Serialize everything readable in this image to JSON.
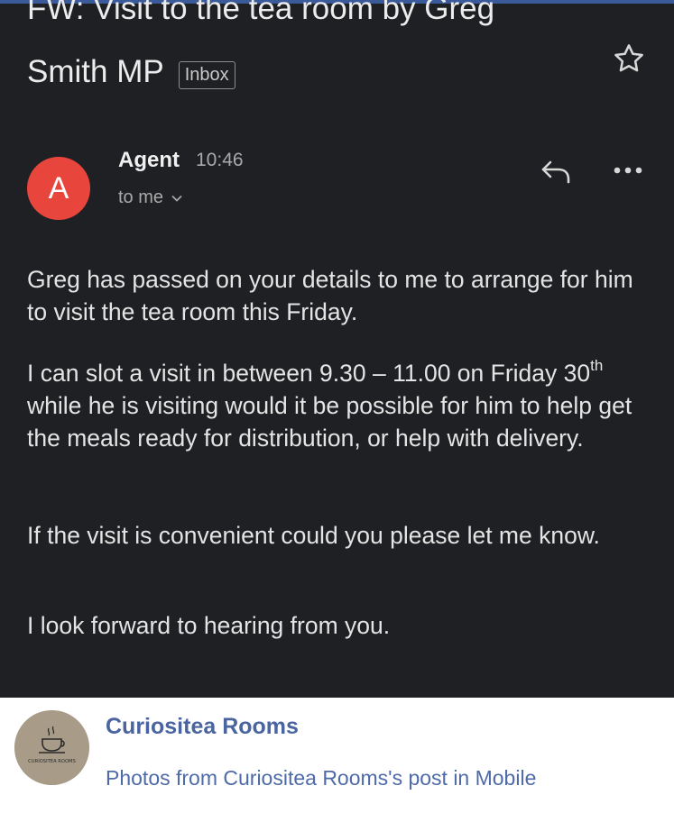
{
  "email": {
    "subject_line1": "FW: Visit to the tea room by Greg",
    "subject_line2": "Smith MP",
    "label": "Inbox",
    "sender": {
      "avatar_letter": "A",
      "avatar_color": "#e8453c",
      "name": "Agent",
      "time": "10:46",
      "recipient": "to me"
    },
    "icons": [
      "star-icon",
      "reply-icon",
      "more-icon",
      "chevron-down-icon"
    ],
    "body": {
      "p1": "Greg has passed on your details to me to arrange for him to visit the tea room this Friday.",
      "p2_a": "I can slot a visit in between 9.30 – 11.00  on Friday 30",
      "p2_sup": "th",
      "p2_b": " while he is visiting would it be possible for him to help get the meals ready for distribution, or help with delivery.",
      "p3": "If the visit is convenient could you please let me know.",
      "p4": "I look forward to hearing from you."
    }
  },
  "facebook_card": {
    "page_name": "Curiositea Rooms",
    "logo_text": "CURIOSITEA ROOMS",
    "caption": "Photos from Curiositea Rooms's post in Mobile"
  }
}
